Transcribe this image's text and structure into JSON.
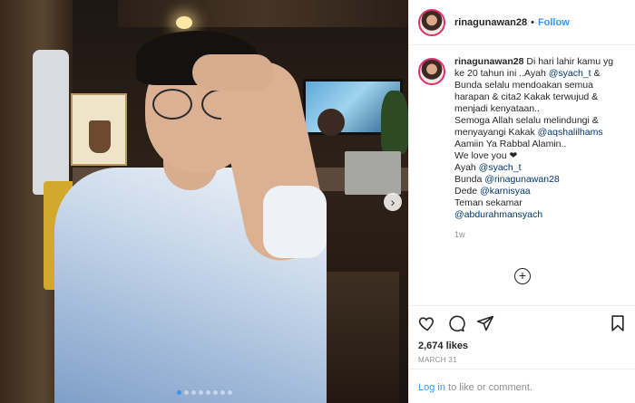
{
  "post": {
    "username": "rinagunawan28",
    "follow_label": "Follow",
    "separator": "•",
    "caption_lines": [
      {
        "text": " Di hari lahir kamu yg ke 20 tahun ini ..Ayah "
      },
      {
        "mention": "@syach_t"
      },
      {
        "text": " & Bunda selalu mendoakan semua harapan & cita2 Kakak terwujud & menjadi kenyataan.."
      },
      {
        "text": "Semoga Allah selalu melindungi & menyayangi Kakak "
      },
      {
        "mention": "@aqshalilhams"
      }
    ],
    "caption_part1": " Di hari lahir kamu yg ke 20 tahun ini ..Ayah ",
    "mention1": "@syach_t",
    "caption_part2": " & Bunda selalu mendoakan semua harapan & cita2 Kakak terwujud & menjadi kenyataan..",
    "caption_part3": "Semoga Allah selalu melindungi & menyayangi Kakak ",
    "mention2": "@aqshalilhams",
    "caption_part4": "Aamiin Ya Rabbal Alamin..",
    "caption_part5": "We love you ❤",
    "ayah_label": "Ayah ",
    "mention3": "@syach_t",
    "bunda_label": "Bunda ",
    "mention4": "@rinagunawan28",
    "dede_label": "Dede ",
    "mention5": "@karnisyaa",
    "teman_label": "Teman sekamar",
    "mention6": "@abdurahmansyach",
    "time_ago": "1w",
    "likes": "2,674 likes",
    "date": "MARCH 31",
    "login_link": "Log in",
    "login_text": " to like or comment."
  },
  "carousel": {
    "total_slides": 8,
    "active_slide": 1,
    "next_icon": "chevron-right-icon"
  },
  "icons": {
    "like": "heart-icon",
    "comment": "comment-icon",
    "share": "paper-plane-icon",
    "save": "bookmark-icon",
    "add_comment": "plus-circle-icon"
  },
  "colors": {
    "link": "#3897f0",
    "mention": "#00376b",
    "muted": "#8e8e8e",
    "story_ring": "#e1306c"
  }
}
